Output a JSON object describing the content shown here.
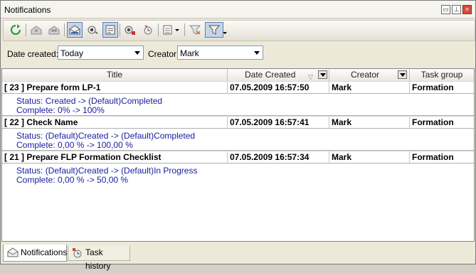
{
  "window": {
    "title": "Notifications"
  },
  "filters": {
    "date_label": "Date created:",
    "date_value": "Today",
    "creator_label": "Creator:",
    "creator_value": "Mark"
  },
  "columns": [
    "Title",
    "Date Created",
    "Creator",
    "Task group"
  ],
  "rows": [
    {
      "title": "[ 23 ] Prepare form LP-1",
      "date": "07.05.2009 16:57:50",
      "creator": "Mark",
      "group": "Formation",
      "status": "Status: Created -> (Default)Completed",
      "complete": "Complete: 0% -> 100%"
    },
    {
      "title": "[ 22 ] Check Name",
      "date": "07.05.2009 16:57:41",
      "creator": "Mark",
      "group": "Formation",
      "status": "Status: (Default)Created -> (Default)Completed",
      "complete": "Complete: 0,00 % -> 100,00 %"
    },
    {
      "title": "[ 21 ] Prepare FLP Formation Checklist",
      "date": "07.05.2009 16:57:34",
      "creator": "Mark",
      "group": "Formation",
      "status": "Status: (Default)Created -> (Default)In Progress",
      "complete": "Complete: 0,00 % -> 50,00 %"
    }
  ],
  "tabs": [
    "Notifications",
    "Task history"
  ],
  "colors": {
    "preview_text": "#1a1aa0",
    "selected_tool": "#c8d4e6"
  }
}
